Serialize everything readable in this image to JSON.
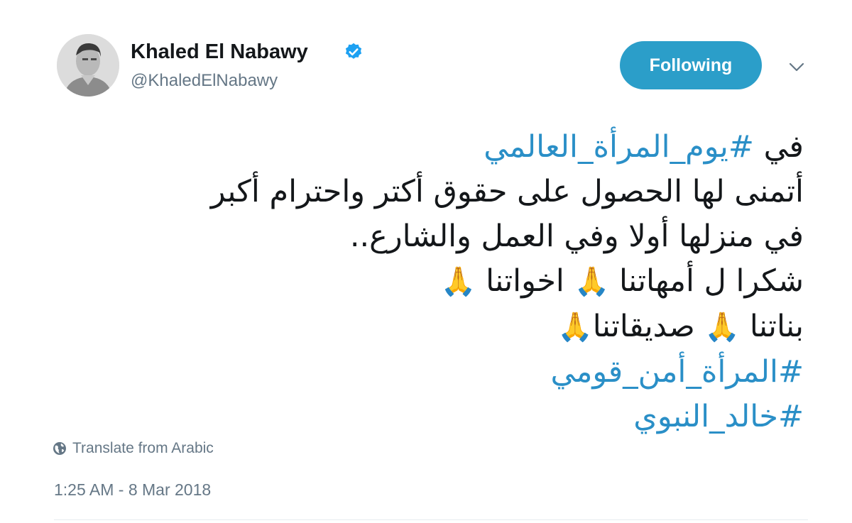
{
  "author": {
    "display_name": "Khaled El Nabawy",
    "handle": "@KhaledElNabawy",
    "verified": true
  },
  "follow_button": {
    "label": "Following"
  },
  "menu": {
    "icon": "chevron-down-icon"
  },
  "tweet": {
    "line1_text": "في ",
    "line1_hashtag": "#يوم_المرأة_العالمي",
    "line2": "أتمنى لها الحصول على حقوق أكتر واحترام أكبر",
    "line3": "في منزلها أولا وفي العمل والشارع..",
    "line4_a": "شكرا ل أمهاتنا ",
    "line4_b": " اخواتنا ",
    "line5_a": "بناتنا ",
    "line5_b": " صديقاتنا",
    "emoji": "🙏",
    "hashtag1": "#المرأة_أمن_قومي",
    "hashtag2": "#خالد_النبوي"
  },
  "translate": {
    "icon": "globe-icon",
    "label": "Translate from Arabic"
  },
  "timestamp": "1:25 AM - 8 Mar 2018",
  "colors": {
    "accent": "#2b9ec9",
    "hashtag": "#2a8fc7",
    "muted": "#657786",
    "text": "#14171a",
    "verified": "#1da1f2"
  }
}
